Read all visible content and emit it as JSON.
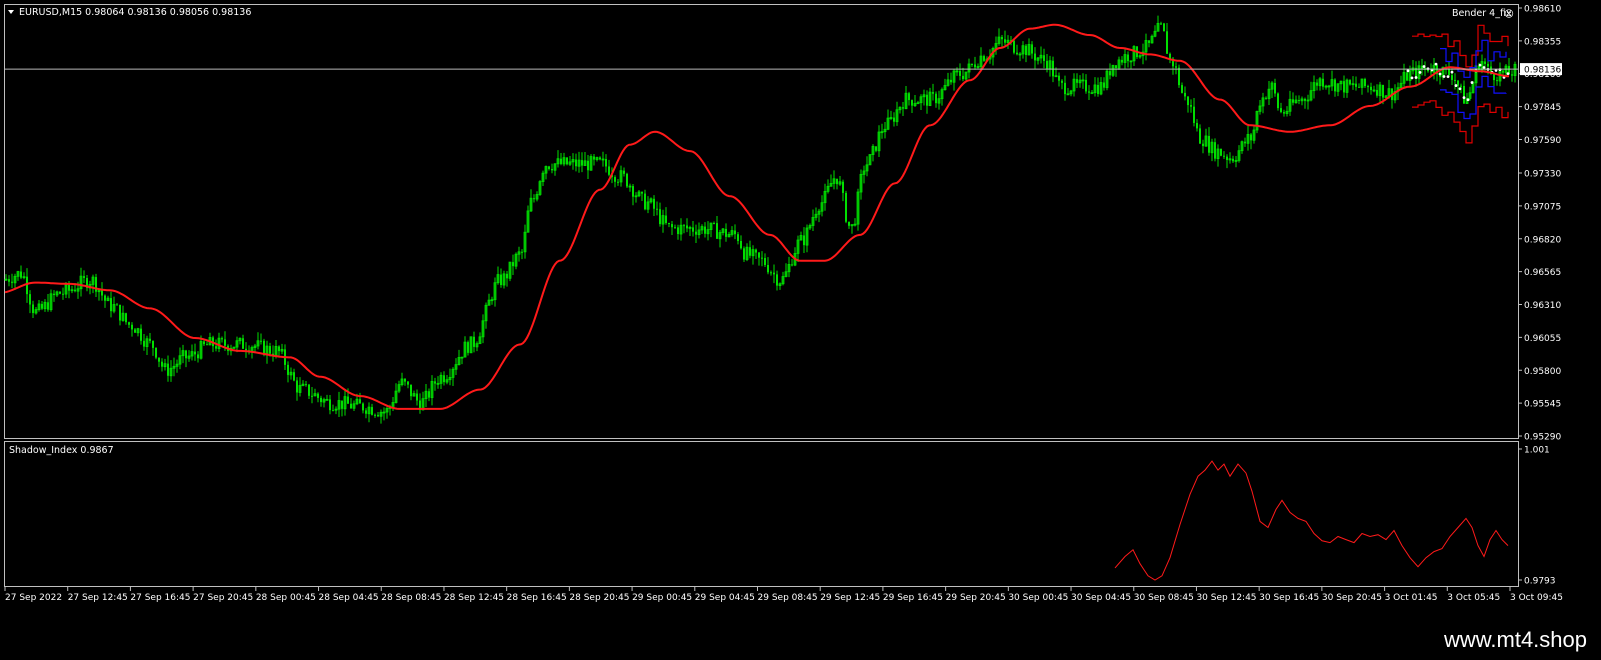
{
  "header": {
    "symbol_line": "EURUSD,M15  0.98064 0.98136 0.98056 0.98136",
    "indicator_name": "Bender 4_fix",
    "smiley": "☺"
  },
  "subwindow": {
    "title": "Shadow_Index 0.9867"
  },
  "watermark": "www.mt4.shop",
  "colors": {
    "background": "#000000",
    "frame": "#c0c0c0",
    "candle": "#00e000",
    "ma": "#ff1a1a",
    "band_outer": "#e00000",
    "band_inner": "#1010ff",
    "dots": "#ffffff",
    "price_line": "#c0c0c0"
  },
  "chart_data": [
    {
      "type": "line",
      "name": "main",
      "price_tag": "0.98136",
      "current_price": 0.98136,
      "ylim": [
        0.9529,
        0.9861
      ],
      "y_ticks": [
        "0.98610",
        "0.98355",
        "0.98100",
        "0.97845",
        "0.97590",
        "0.97330",
        "0.97075",
        "0.96820",
        "0.96565",
        "0.96310",
        "0.96055",
        "0.95800",
        "0.95545",
        "0.95290"
      ],
      "y_tick_values": [
        0.9861,
        0.98355,
        0.981,
        0.97845,
        0.9759,
        0.9733,
        0.97075,
        0.9682,
        0.96565,
        0.9631,
        0.96055,
        0.958,
        0.95545,
        0.9529
      ],
      "x_ticks": [
        "27 Sep 2022",
        "27 Sep 12:45",
        "27 Sep 16:45",
        "27 Sep 20:45",
        "28 Sep 00:45",
        "28 Sep 04:45",
        "28 Sep 08:45",
        "28 Sep 12:45",
        "28 Sep 16:45",
        "28 Sep 20:45",
        "29 Sep 00:45",
        "29 Sep 04:45",
        "29 Sep 08:45",
        "29 Sep 12:45",
        "29 Sep 16:45",
        "29 Sep 20:45",
        "30 Sep 00:45",
        "30 Sep 04:45",
        "30 Sep 08:45",
        "30 Sep 12:45",
        "30 Sep 16:45",
        "30 Sep 20:45",
        "3 Oct 01:45",
        "3 Oct 05:45",
        "3 Oct 09:45"
      ],
      "price_keyframes": [
        [
          0,
          0.965
        ],
        [
          20,
          0.9655
        ],
        [
          35,
          0.9625
        ],
        [
          60,
          0.964
        ],
        [
          90,
          0.965
        ],
        [
          110,
          0.963
        ],
        [
          130,
          0.9615
        ],
        [
          150,
          0.96
        ],
        [
          165,
          0.958
        ],
        [
          185,
          0.959
        ],
        [
          210,
          0.96
        ],
        [
          245,
          0.96
        ],
        [
          275,
          0.9595
        ],
        [
          300,
          0.9565
        ],
        [
          330,
          0.9555
        ],
        [
          360,
          0.9552
        ],
        [
          385,
          0.9548
        ],
        [
          400,
          0.957
        ],
        [
          420,
          0.9555
        ],
        [
          440,
          0.9575
        ],
        [
          470,
          0.96
        ],
        [
          500,
          0.965
        ],
        [
          520,
          0.967
        ],
        [
          530,
          0.971
        ],
        [
          545,
          0.974
        ],
        [
          570,
          0.974
        ],
        [
          600,
          0.974
        ],
        [
          620,
          0.973
        ],
        [
          645,
          0.971
        ],
        [
          670,
          0.969
        ],
        [
          700,
          0.969
        ],
        [
          735,
          0.9685
        ],
        [
          745,
          0.967
        ],
        [
          760,
          0.9665
        ],
        [
          780,
          0.965
        ],
        [
          800,
          0.968
        ],
        [
          820,
          0.971
        ],
        [
          835,
          0.973
        ],
        [
          850,
          0.969
        ],
        [
          865,
          0.974
        ],
        [
          885,
          0.977
        ],
        [
          905,
          0.979
        ],
        [
          930,
          0.979
        ],
        [
          960,
          0.981
        ],
        [
          985,
          0.9825
        ],
        [
          1000,
          0.9835
        ],
        [
          1020,
          0.983
        ],
        [
          1045,
          0.982
        ],
        [
          1060,
          0.98
        ],
        [
          1080,
          0.98
        ],
        [
          1100,
          0.98
        ],
        [
          1115,
          0.982
        ],
        [
          1130,
          0.9825
        ],
        [
          1145,
          0.983
        ],
        [
          1160,
          0.9845
        ],
        [
          1170,
          0.982
        ],
        [
          1185,
          0.979
        ],
        [
          1200,
          0.976
        ],
        [
          1215,
          0.975
        ],
        [
          1230,
          0.9745
        ],
        [
          1250,
          0.976
        ],
        [
          1260,
          0.979
        ],
        [
          1270,
          0.98
        ],
        [
          1280,
          0.978
        ],
        [
          1300,
          0.979
        ],
        [
          1320,
          0.9805
        ],
        [
          1345,
          0.98
        ],
        [
          1370,
          0.98
        ],
        [
          1390,
          0.9795
        ],
        [
          1410,
          0.981
        ],
        [
          1430,
          0.9815
        ],
        [
          1450,
          0.981
        ],
        [
          1465,
          0.979
        ],
        [
          1480,
          0.982
        ],
        [
          1490,
          0.981
        ],
        [
          1505,
          0.981
        ],
        [
          1515,
          0.9812
        ]
      ],
      "ma_keyframes": [
        [
          0,
          0.964
        ],
        [
          35,
          0.9648
        ],
        [
          70,
          0.9647
        ],
        [
          110,
          0.9642
        ],
        [
          150,
          0.9628
        ],
        [
          195,
          0.9605
        ],
        [
          240,
          0.9595
        ],
        [
          290,
          0.959
        ],
        [
          320,
          0.9575
        ],
        [
          360,
          0.956
        ],
        [
          400,
          0.955
        ],
        [
          440,
          0.955
        ],
        [
          480,
          0.9565
        ],
        [
          520,
          0.96
        ],
        [
          560,
          0.9665
        ],
        [
          600,
          0.972
        ],
        [
          630,
          0.9755
        ],
        [
          655,
          0.9765
        ],
        [
          690,
          0.975
        ],
        [
          730,
          0.9715
        ],
        [
          770,
          0.9685
        ],
        [
          800,
          0.9665
        ],
        [
          825,
          0.9665
        ],
        [
          860,
          0.9685
        ],
        [
          895,
          0.9725
        ],
        [
          930,
          0.977
        ],
        [
          970,
          0.9805
        ],
        [
          1000,
          0.983
        ],
        [
          1030,
          0.9845
        ],
        [
          1055,
          0.9848
        ],
        [
          1090,
          0.984
        ],
        [
          1120,
          0.983
        ],
        [
          1150,
          0.9825
        ],
        [
          1180,
          0.982
        ],
        [
          1220,
          0.979
        ],
        [
          1250,
          0.977
        ],
        [
          1290,
          0.9765
        ],
        [
          1330,
          0.977
        ],
        [
          1370,
          0.9785
        ],
        [
          1410,
          0.98
        ],
        [
          1450,
          0.9815
        ],
        [
          1480,
          0.9812
        ],
        [
          1510,
          0.9808
        ]
      ]
    },
    {
      "type": "line",
      "name": "Shadow_Index",
      "ylim": [
        0.9793,
        1.001
      ],
      "y_ticks": [
        "1.001",
        "0.9793"
      ],
      "y_tick_values": [
        1.001,
        0.9793
      ],
      "x_range": [
        1115,
        1510
      ],
      "values": [
        [
          1115,
          0.9813
        ],
        [
          1125,
          0.9832
        ],
        [
          1133,
          0.9843
        ],
        [
          1140,
          0.982
        ],
        [
          1148,
          0.98
        ],
        [
          1155,
          0.9793
        ],
        [
          1162,
          0.98
        ],
        [
          1170,
          0.983
        ],
        [
          1180,
          0.9885
        ],
        [
          1190,
          0.9935
        ],
        [
          1198,
          0.9965
        ],
        [
          1205,
          0.9975
        ],
        [
          1212,
          0.999
        ],
        [
          1218,
          0.9975
        ],
        [
          1224,
          0.9985
        ],
        [
          1230,
          0.9965
        ],
        [
          1238,
          0.9985
        ],
        [
          1246,
          0.997
        ],
        [
          1252,
          0.994
        ],
        [
          1260,
          0.989
        ],
        [
          1268,
          0.988
        ],
        [
          1276,
          0.991
        ],
        [
          1282,
          0.9925
        ],
        [
          1290,
          0.9905
        ],
        [
          1298,
          0.9895
        ],
        [
          1306,
          0.989
        ],
        [
          1314,
          0.987
        ],
        [
          1322,
          0.9858
        ],
        [
          1330,
          0.9855
        ],
        [
          1338,
          0.9865
        ],
        [
          1346,
          0.986
        ],
        [
          1354,
          0.9855
        ],
        [
          1362,
          0.987
        ],
        [
          1370,
          0.9865
        ],
        [
          1378,
          0.9868
        ],
        [
          1386,
          0.986
        ],
        [
          1394,
          0.9875
        ],
        [
          1402,
          0.985
        ],
        [
          1410,
          0.983
        ],
        [
          1418,
          0.9815
        ],
        [
          1426,
          0.983
        ],
        [
          1434,
          0.984
        ],
        [
          1442,
          0.9845
        ],
        [
          1450,
          0.9865
        ],
        [
          1458,
          0.988
        ],
        [
          1466,
          0.9895
        ],
        [
          1472,
          0.988
        ],
        [
          1478,
          0.985
        ],
        [
          1484,
          0.9832
        ],
        [
          1490,
          0.986
        ],
        [
          1496,
          0.9875
        ],
        [
          1502,
          0.986
        ],
        [
          1508,
          0.985
        ]
      ]
    }
  ]
}
